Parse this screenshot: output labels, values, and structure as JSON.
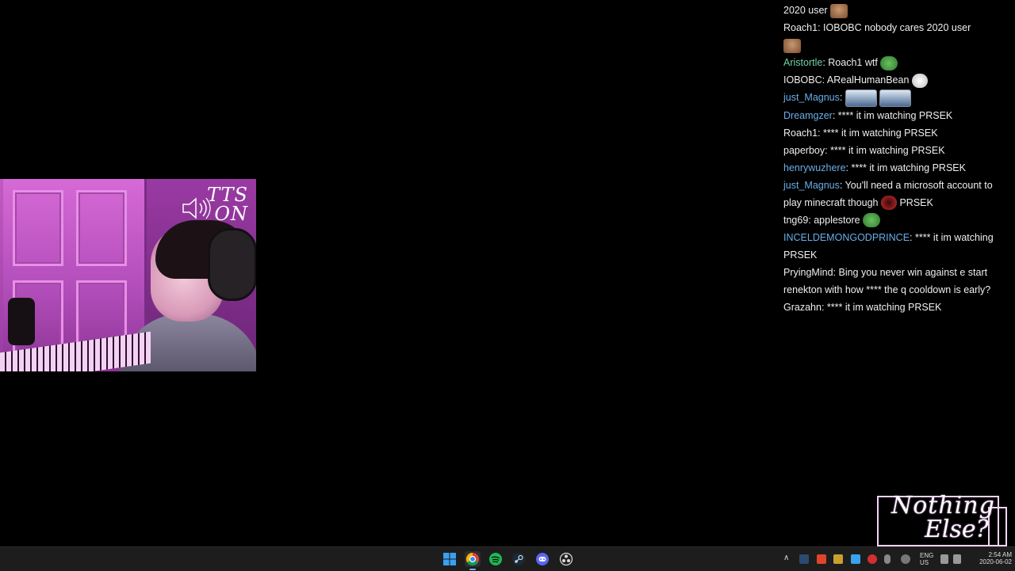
{
  "webcam": {
    "tts_line1": "TTS",
    "tts_line2": "ON"
  },
  "chat": {
    "messages": [
      {
        "user": "",
        "text": "2020 user",
        "user_color": "#efefef",
        "emote_after": "dog"
      },
      {
        "user": "Roach1",
        "text": ": IOBOBC nobody cares 2020 user",
        "user_color": "#efefef",
        "emote_newline": "dog"
      },
      {
        "user": "Aristortle",
        "text": ": Roach1 wtf",
        "user_color": "#6fd3a4",
        "emote_after": "pepe"
      },
      {
        "user": "IOBOBC",
        "text": ": ARealHumanBean",
        "user_color": "#efefef",
        "emote_after": "troll"
      },
      {
        "user": "just_Magnus",
        "text": ":",
        "user_color": "#6aaee8",
        "emote_after": "pic2"
      },
      {
        "user": "Dreamgzer",
        "text": ": **** it im watching PRSEK",
        "user_color": "#6aaee8"
      },
      {
        "user": "Roach1",
        "text": ": **** it im watching PRSEK",
        "user_color": "#efefef"
      },
      {
        "user": "paperboy",
        "text": ": **** it im watching PRSEK",
        "user_color": "#efefef"
      },
      {
        "user": "henrywuzhere",
        "text": ": **** it im watching PRSEK",
        "user_color": "#6aaee8"
      },
      {
        "user": "just_Magnus",
        "text": ": You'll need a microsoft account to play minecraft though",
        "user_color": "#6aaee8",
        "emote_after": "orb",
        "text_after": " PRSEK"
      },
      {
        "user": "tng69",
        "text": ": applestore",
        "user_color": "#efefef",
        "emote_after": "pepe"
      },
      {
        "user": "INCELDEMONGODPRINCE",
        "text": ": **** it im watching PRSEK",
        "user_color": "#6aaee8"
      },
      {
        "user": "PryingMind",
        "text": ": Bing you never win against e start renekton with how **** the q cooldown is early?",
        "user_color": "#efefef"
      },
      {
        "user": "Grazahn",
        "text": ": **** it im watching PRSEK",
        "user_color": "#efefef"
      }
    ]
  },
  "logo": {
    "line1": "Nothing",
    "line2": "Else?"
  },
  "taskbar": {
    "apps": [
      {
        "name": "start-button",
        "icon": "windows-icon",
        "color": "#3aa0f0"
      },
      {
        "name": "chrome-button",
        "icon": "chrome-icon",
        "color": "#e6b820",
        "active": true
      },
      {
        "name": "spotify-button",
        "icon": "spotify-icon",
        "color": "#1db954"
      },
      {
        "name": "steam-button",
        "icon": "steam-icon",
        "color": "#2a4a70"
      },
      {
        "name": "discord-button",
        "icon": "discord-icon",
        "color": "#5865f2"
      },
      {
        "name": "obs-button",
        "icon": "obs-icon",
        "color": "#505050"
      }
    ],
    "lang_line1": "ENG",
    "lang_line2": "US",
    "time": "2:54 AM",
    "date": "2020-06-02"
  }
}
